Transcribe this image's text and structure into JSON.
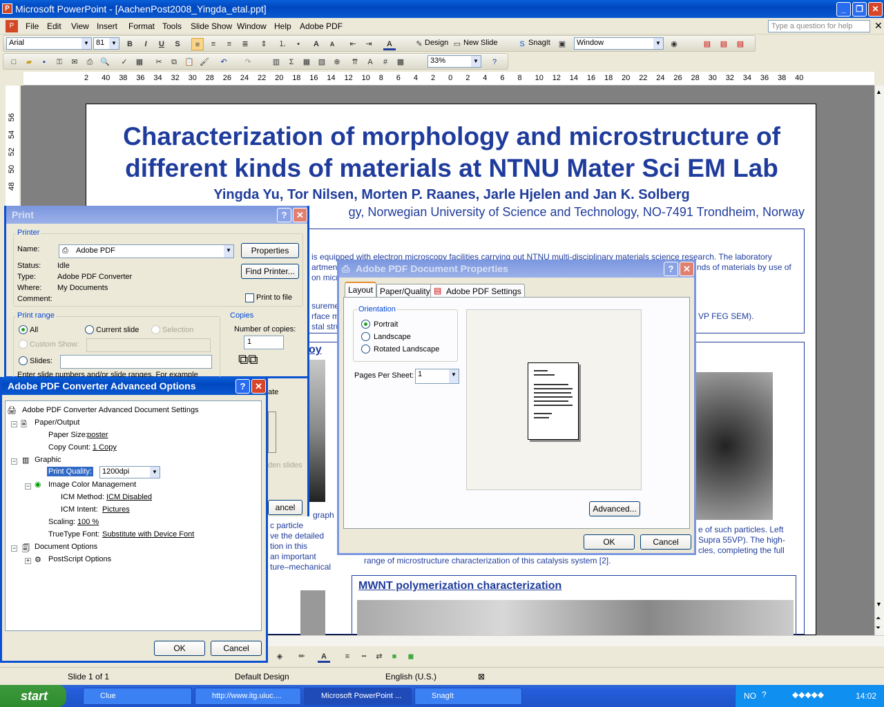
{
  "app": {
    "title": "Microsoft PowerPoint - [AachenPost2008_Yingda_etal.ppt]",
    "menus": [
      "File",
      "Edit",
      "View",
      "Insert",
      "Format",
      "Tools",
      "Slide Show",
      "Window",
      "Help",
      "Adobe PDF"
    ],
    "ask_placeholder": "Type a question for help"
  },
  "toolbar": {
    "font": "Arial",
    "font_size": "81",
    "design_label": "Design",
    "new_slide_label": "New Slide",
    "snagit_label": "SnagIt",
    "window_combo": "Window",
    "zoom": "33%"
  },
  "ruler": {
    "h_ticks": [
      "2",
      "40",
      "38",
      "36",
      "34",
      "32",
      "30",
      "28",
      "26",
      "24",
      "22",
      "20",
      "18",
      "16",
      "14",
      "12",
      "10",
      "8",
      "6",
      "4",
      "2",
      "0",
      "2",
      "4",
      "6",
      "8",
      "10",
      "12",
      "14",
      "16",
      "18",
      "20",
      "22",
      "24",
      "26",
      "28",
      "30",
      "32",
      "34",
      "36",
      "38",
      "40"
    ],
    "v_ticks": [
      "56",
      "54",
      "52",
      "50",
      "48"
    ]
  },
  "slide": {
    "title_line1": "Characterization of morphology and microstructure of",
    "title_line2": "different kinds of materials at NTNU Mater Sci EM Lab",
    "authors": "Yingda Yu, Tor Nilsen, Morten P. Raanes, Jarle Hjelen and Jan K. Solberg",
    "affiliation": "gy, Norwegian University of Science and Technology, NO-7491 Trondheim, Norway",
    "intro_line1": "is equipped with electron microscopy facilities carrying out NTNU multi-disciplinary materials science research. The laboratory",
    "intro_line2": "artment",
    "intro_line2b": "nds of materials by use of",
    "intro_line3": "on micr",
    "meas1": "sureme",
    "meas2": "rface m",
    "meas3": "stal stru",
    "sem_text": "VP FEG SEM).",
    "section_oy": "oy",
    "left_col": [
      "graph",
      "c particle",
      "ve the detailed",
      "tion in this",
      "an important",
      "ture–mechanical"
    ],
    "right_col1": "e of such particles. Left",
    "right_col2": "Supra 55VP). The high-",
    "right_col3": "cles, completing the full",
    "right_col4": "range of microstructure characterization of this catalysis system [2].",
    "mwnt_heading": "MWNT polymerization characterization"
  },
  "status": {
    "slide_of": "Slide 1 of 1",
    "design": "Default Design",
    "language": "English (U.S.)"
  },
  "taskbar": {
    "start": "start",
    "items": [
      "Clue",
      "http://www.itg.uiuc....",
      "Microsoft PowerPoint ...",
      "SnagIt"
    ],
    "tray_lang": "NO",
    "time": "14:02"
  },
  "print_dialog": {
    "title": "Print",
    "printer_group": "Printer",
    "name_label": "Name:",
    "name_value": "Adobe PDF",
    "properties": "Properties",
    "status_label": "Status:",
    "status_value": "Idle",
    "type_label": "Type:",
    "type_value": "Adobe PDF Converter",
    "where_label": "Where:",
    "where_value": "My Documents",
    "comment_label": "Comment:",
    "find_printer": "Find Printer...",
    "print_to_file": "Print to file",
    "range_group": "Print range",
    "all": "All",
    "current_slide": "Current slide",
    "selection": "Selection",
    "custom_show": "Custom Show:",
    "slides": "Slides:",
    "enter_hint": "Enter slide numbers and/or slide ranges. For example",
    "copies_group": "Copies",
    "num_copies_label": "Number of copies:",
    "num_copies": "1",
    "collate": "ate",
    "hidden": "den slides",
    "cancel": "ancel"
  },
  "adv_dialog": {
    "title": "Adobe PDF Converter Advanced Options",
    "root": "Adobe PDF Converter Advanced Document Settings",
    "paper_output": "Paper/Output",
    "paper_size_label": "Paper Size:",
    "paper_size_value": "poster",
    "copy_count_label": "Copy Count:",
    "copy_count_value": "1 Copy",
    "graphic": "Graphic",
    "print_quality_label": "Print Quality:",
    "print_quality_value": "1200dpi",
    "icm": "Image Color Management",
    "icm_method_label": "ICM Method:",
    "icm_method_value": "ICM Disabled",
    "icm_intent_label": "ICM Intent:",
    "icm_intent_value": "Pictures",
    "scaling_label": "Scaling:",
    "scaling_value": "100 %",
    "truetype_label": "TrueType Font:",
    "truetype_value": "Substitute with Device Font",
    "doc_options": "Document Options",
    "postscript": "PostScript Options",
    "ok": "OK",
    "cancel": "Cancel"
  },
  "props_dialog": {
    "title": "Adobe PDF Document Properties",
    "tabs": [
      "Layout",
      "Paper/Quality",
      "Adobe PDF Settings"
    ],
    "orientation_group": "Orientation",
    "portrait": "Portrait",
    "landscape": "Landscape",
    "rotated": "Rotated Landscape",
    "pps_label": "Pages Per Sheet:",
    "pps_value": "1",
    "advanced": "Advanced...",
    "ok": "OK",
    "cancel": "Cancel"
  }
}
